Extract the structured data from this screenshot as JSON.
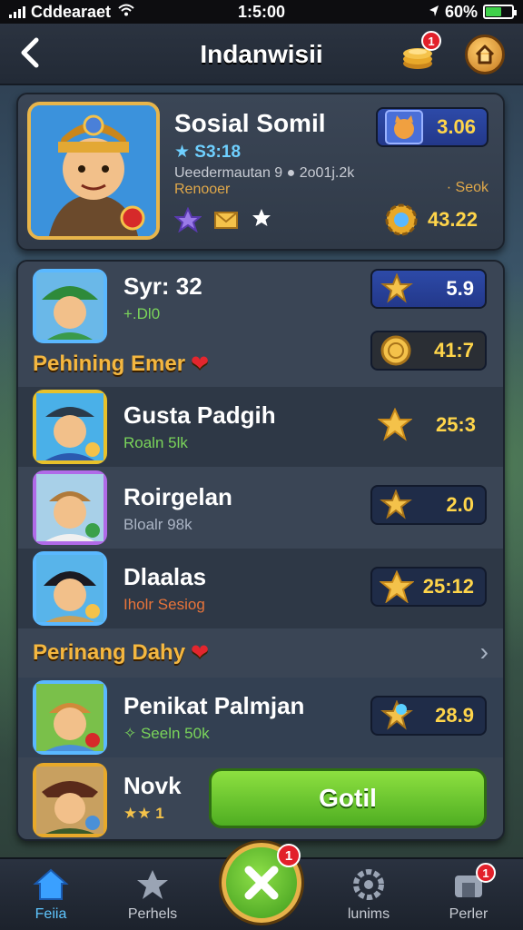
{
  "status_bar": {
    "carrier": "Cddearaet",
    "time": "1:5:00",
    "battery": "60%",
    "battery_level": 0.6
  },
  "header": {
    "back_icon": "chevron-left-icon",
    "title": "Indanwisii",
    "coins_badge": "1",
    "home_icon": "home-icon"
  },
  "profile": {
    "name": "Sosial Somil",
    "stat": "★ S3:18",
    "level_line": "Ueedermautan 9 ● 2o01j.2k",
    "sub_line": "Renooer",
    "seek": "· Seok",
    "cat_value": "3.06",
    "coin_value": "43.22"
  },
  "rows": [
    {
      "name": "Syr: 32",
      "sub": "+.Dl0",
      "value_a": "5.9",
      "value_b": "41:7"
    },
    {
      "name": "Gusta Padgih",
      "sub": "Roaln 5lk",
      "value": "25:3"
    },
    {
      "name": "Roirgelan",
      "sub": "Bloalr 98k",
      "value": "2.0"
    },
    {
      "name": "Dlaalas",
      "sub": "Iholr Sesiog",
      "value": "25:12"
    },
    {
      "name": "Penikat Palmjan",
      "sub": "✧ Seeln 50k",
      "value": "28.9"
    },
    {
      "name": "Novk",
      "sub": "1"
    }
  ],
  "sections": {
    "first": "Pehining Emer",
    "second": "Perinang Dahy"
  },
  "cta": {
    "label": "Gotil"
  },
  "nav": {
    "items": [
      {
        "label": "Feiia"
      },
      {
        "label": "Perhels"
      },
      {
        "label": "lunims"
      },
      {
        "label": "Perler"
      }
    ],
    "fab_badge": "1",
    "last_badge": "1"
  },
  "colors": {
    "accent_gold": "#f4b740",
    "value_yellow": "#ffd54a",
    "cta_green": "#5fbd2a",
    "badge_red": "#e2202a"
  }
}
